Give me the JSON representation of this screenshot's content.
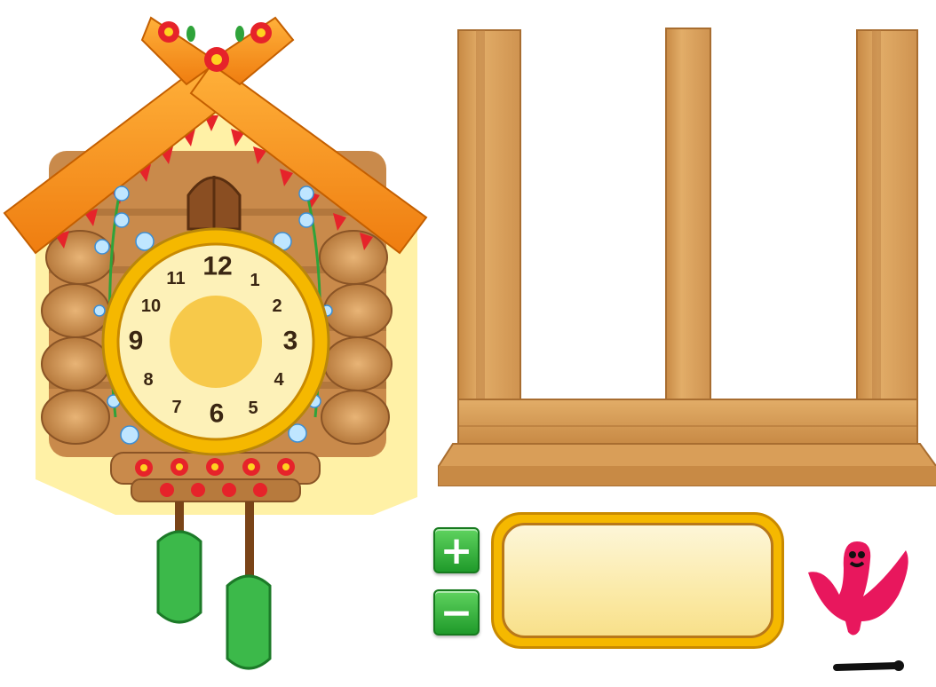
{
  "clock": {
    "numbers": [
      "12",
      "1",
      "2",
      "3",
      "4",
      "5",
      "6",
      "7",
      "8",
      "9",
      "10",
      "11"
    ]
  },
  "controls": {
    "plus_label": "+",
    "minus_label": "−",
    "answer_value": ""
  },
  "colors": {
    "roof": "#f7941d",
    "log": "#c98a4b",
    "clock_face": "#fdf1b8",
    "clock_rim": "#f5b800",
    "button_green": "#2fb83a",
    "wood": "#d9a15a",
    "bird": "#e8175d"
  }
}
